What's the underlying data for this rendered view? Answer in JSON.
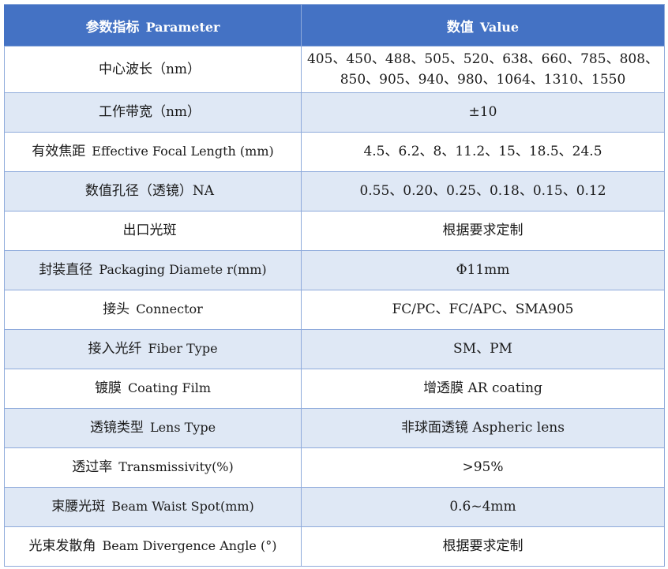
{
  "header": {
    "param_cn": "参数指标",
    "param_en": "Parameter",
    "value_cn": "数值",
    "value_en": "Value"
  },
  "rows": [
    {
      "param_cn": "中心波长（nm）",
      "param_en": "",
      "value": "405、450、488、505、520、638、660、785、808、850、905、940、980、1064、1310、1550"
    },
    {
      "param_cn": "工作带宽（nm）",
      "param_en": "",
      "value": "±10"
    },
    {
      "param_cn": "有效焦距",
      "param_en": "Effective Focal Length (mm)",
      "value": "4.5、6.2、8、11.2、15、18.5、24.5"
    },
    {
      "param_cn": "数值孔径（透镜）NA",
      "param_en": "",
      "value": "0.55、0.20、0.25、0.18、0.15、0.12"
    },
    {
      "param_cn": "出口光斑",
      "param_en": "",
      "value": "根据要求定制"
    },
    {
      "param_cn": "封装直径",
      "param_en": "Packaging Diamete r(mm)",
      "value": "Φ11mm"
    },
    {
      "param_cn": "接头",
      "param_en": "Connector",
      "value": "FC/PC、FC/APC、SMA905"
    },
    {
      "param_cn": "接入光纤",
      "param_en": "Fiber Type",
      "value": "SM、PM"
    },
    {
      "param_cn": "镀膜",
      "param_en": "Coating Film",
      "value": "增透膜  AR coating"
    },
    {
      "param_cn": "透镜类型",
      "param_en": "Lens Type",
      "value": "非球面透镜  Aspheric lens"
    },
    {
      "param_cn": "透过率",
      "param_en": "Transmissivity(%)",
      "value": ">95%"
    },
    {
      "param_cn": "束腰光斑",
      "param_en": "Beam Waist Spot(mm)",
      "value": "0.6~4mm"
    },
    {
      "param_cn": "光束发散角",
      "param_en": "Beam Divergence Angle (°)",
      "value": "根据要求定制"
    }
  ]
}
